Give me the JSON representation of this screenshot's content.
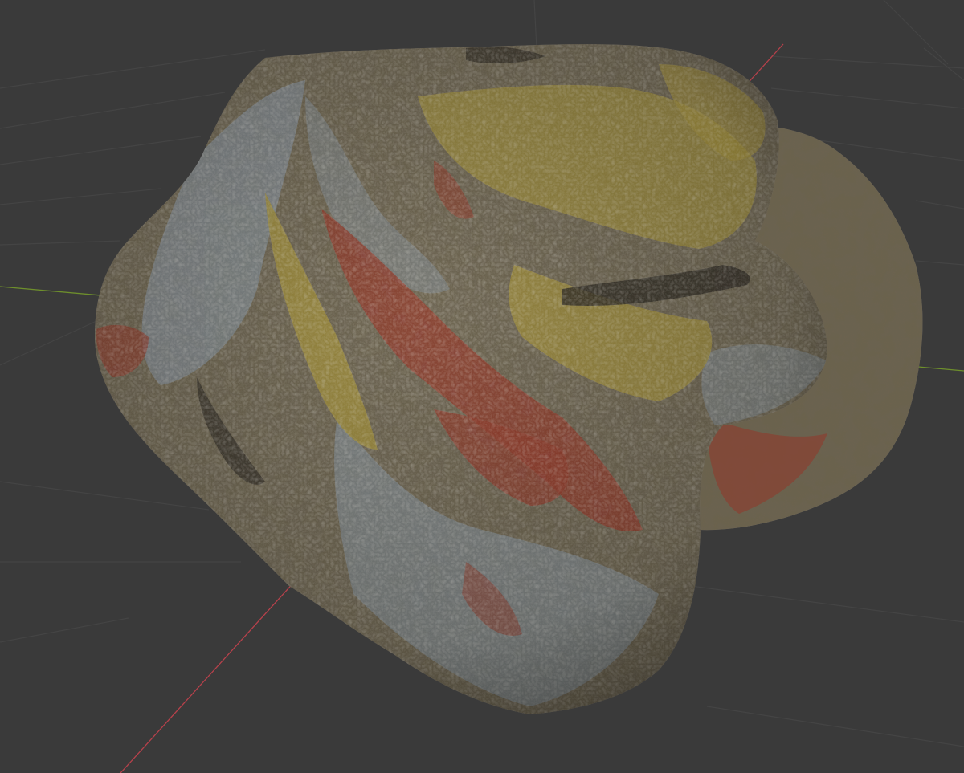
{
  "viewport": {
    "background": "#3a3a3a",
    "grid_line_color": "#444444",
    "axis_x_color": "#b8414b",
    "axis_y_color": "#6e8f2c",
    "object": "rock-mesh",
    "rock_palette": {
      "base": "#6b6250",
      "grey_blue": "#7f8a93",
      "ochre": "#a08e3a",
      "red_vein": "#8f3b2d",
      "dark": "#2f2a22",
      "highlight": "#b9b3a2"
    }
  }
}
